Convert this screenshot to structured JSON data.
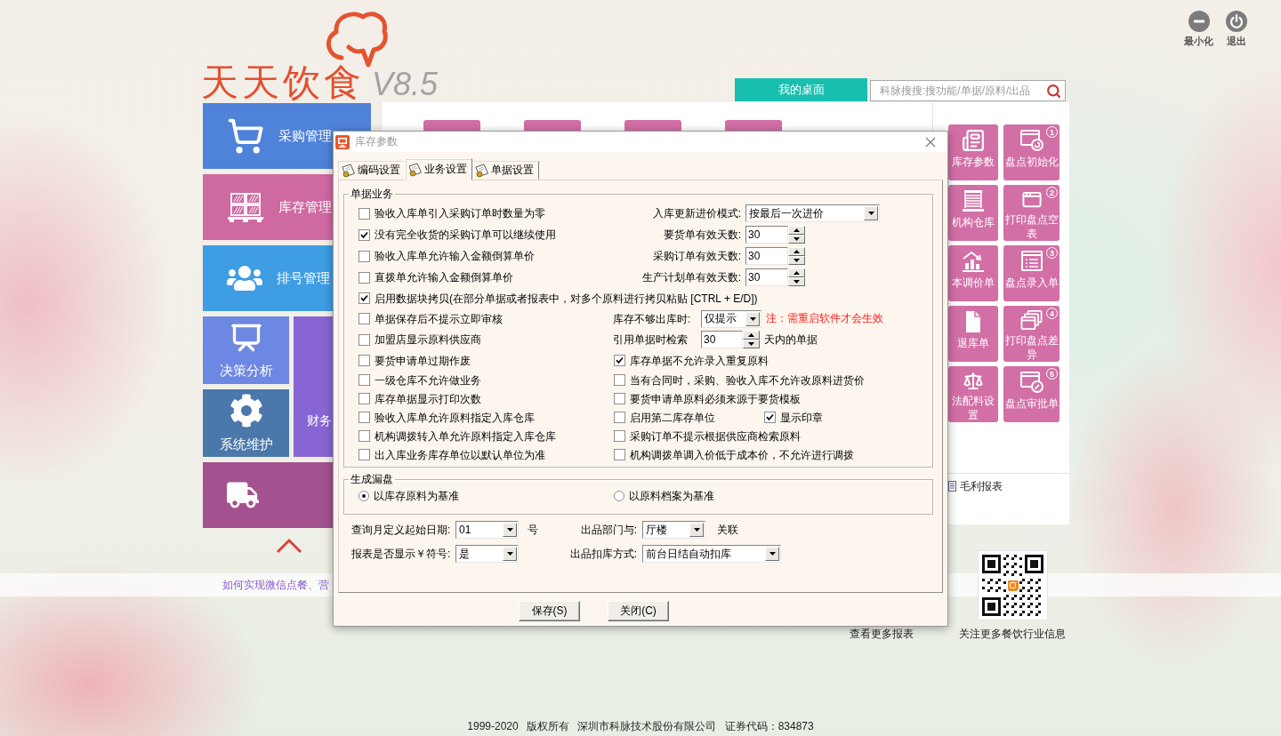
{
  "window_controls": [
    {
      "kind": "minimize",
      "label": "最小化"
    },
    {
      "kind": "exit",
      "label": "退出"
    }
  ],
  "logo": {
    "name": "天天饮食",
    "version": "V8.5"
  },
  "desktop_tab": {
    "label": "我的桌面"
  },
  "search": {
    "placeholder": "科脉搜搜:搜功能/单据/原料/出品"
  },
  "nav": [
    {
      "kind": "wide",
      "label": "采购管理",
      "color": "#4f82d9"
    },
    {
      "kind": "wide",
      "label": "库存管理",
      "color": "#cf69a2"
    },
    {
      "kind": "wide",
      "label": "排号管理",
      "color": "#3e9de3"
    },
    {
      "kind": "small",
      "label": "决策分析",
      "color": "#6d88e2"
    },
    {
      "kind": "tall",
      "label": "财务",
      "color": "#8766d4"
    },
    {
      "kind": "small",
      "label": "系统维护",
      "color": "#4b78aa"
    },
    {
      "kind": "wide",
      "color": "#a3528f"
    }
  ],
  "tiles": [
    {
      "label": "库存参数"
    },
    {
      "label": "盘点初始化",
      "step": "1"
    },
    {
      "label": "机构仓库"
    },
    {
      "label": "打印盘点空表",
      "step": "2"
    },
    {
      "label": "本调价单"
    },
    {
      "label": "盘点录入单",
      "step": "3"
    },
    {
      "label": "退库单"
    },
    {
      "label": "打印盘点差异",
      "step": "4"
    },
    {
      "label": "法配料设置"
    },
    {
      "label": "盘点审批单",
      "step": "5"
    }
  ],
  "report_link": {
    "label": "毛利报表"
  },
  "news_link": {
    "label": "如何实现微信点餐、营"
  },
  "more_reports": {
    "label": "查看更多报表"
  },
  "qr_caption": "关注更多餐饮行业信息",
  "footer": "1999-2020 版权所有 深圳市科脉技术股份有限公司 证券代码：834873",
  "dialog": {
    "title": "库存参数",
    "tabs": [
      {
        "label": "编码设置",
        "selected": false
      },
      {
        "label": "业务设置",
        "selected": true
      },
      {
        "label": "单据设置",
        "selected": false
      }
    ],
    "business_group": {
      "title": "单据业务",
      "rows": [
        {
          "kind": "split",
          "left": {
            "label": "验收入库单引入采购订单时数量为零",
            "checked": false
          },
          "right": {
            "kind": "combo",
            "label": "入库更新进价模式:",
            "value": "按最后一次进价"
          }
        },
        {
          "kind": "split",
          "left": {
            "label": "没有完全收货的采购订单可以继续使用",
            "checked": true
          },
          "right": {
            "kind": "spin",
            "label": "要货单有效天数:",
            "value": "30"
          }
        },
        {
          "kind": "split",
          "left": {
            "label": "验收入库单允许输入金额倒算单价",
            "checked": false
          },
          "right": {
            "kind": "spin",
            "label": "采购订单有效天数:",
            "value": "30"
          }
        },
        {
          "kind": "split",
          "left": {
            "label": "直拨单允许输入金额倒算单价",
            "checked": false
          },
          "right": {
            "kind": "spin",
            "label": "生产计划单有效天数:",
            "value": "30"
          }
        },
        {
          "kind": "wide",
          "left": {
            "label": "启用数据块拷贝(在部分单据或者报表中，对多个原料进行拷贝粘贴 [CTRL + E/D])",
            "checked": true
          }
        },
        {
          "kind": "split",
          "left": {
            "label": "单据保存后不提示立即审核",
            "checked": false
          },
          "right": {
            "kind": "combo_note",
            "label": "库存不够出库时:",
            "value": "仅提示",
            "note": "注：需重启软件才会生效"
          }
        },
        {
          "kind": "split",
          "left": {
            "label": "加盟店显示原料供应商",
            "checked": false
          },
          "right": {
            "kind": "spin_suffix",
            "label": "引用单据时检索",
            "value": "30",
            "suffix": "天内的单据"
          }
        },
        {
          "kind": "split",
          "left": {
            "label": "要货申请单过期作废",
            "checked": false
          },
          "right": {
            "kind": "checkbox",
            "label": "库存单据不允许录入重复原料",
            "checked": true
          }
        },
        {
          "kind": "split",
          "left": {
            "label": "一级仓库不允许做业务",
            "checked": false
          },
          "right": {
            "kind": "checkbox",
            "label": "当有合同时，采购、验收入库不允许改原料进货价",
            "checked": false
          }
        },
        {
          "kind": "split",
          "left": {
            "label": "库存单据显示打印次数",
            "checked": false
          },
          "right": {
            "kind": "checkbox",
            "label": "要货申请单原料必须来源于要货模板",
            "checked": false
          }
        },
        {
          "kind": "split",
          "left": {
            "label": "验收入库单允许原料指定入库仓库",
            "checked": false
          },
          "right": {
            "kind": "checkbox_pair",
            "label": "启用第二库存单位",
            "checked": false,
            "extra": {
              "label": "显示印章",
              "checked": true
            }
          }
        },
        {
          "kind": "split",
          "left": {
            "label": "机构调拨转入单允许原料指定入库仓库",
            "checked": false
          },
          "right": {
            "kind": "checkbox",
            "label": "采购订单不提示根据供应商检索原料",
            "checked": false
          }
        },
        {
          "kind": "split",
          "left": {
            "label": "出入库业务库存单位以默认单位为准",
            "checked": false
          },
          "right": {
            "kind": "checkbox",
            "label": "机构调拨单调入价低于成本价，不允许进行调拨",
            "checked": false
          }
        }
      ]
    },
    "stocktake_group": {
      "title": "生成漏盘",
      "options": [
        {
          "label": "以库存原料为基准",
          "selected": true
        },
        {
          "label": "以原料档案为基准",
          "selected": false
        }
      ]
    },
    "fields": [
      {
        "label": "查询月定义起始日期:",
        "value": "01",
        "suffix": "号"
      },
      {
        "label": "出品部门与:",
        "value": "厅楼",
        "suffix": "关联"
      },
      {
        "label": "报表是否显示￥符号:",
        "value": "是"
      },
      {
        "label": "出品扣库方式:",
        "value": "前台日结自动扣库"
      }
    ],
    "buttons": [
      "保存(S)",
      "关闭(C)"
    ]
  }
}
